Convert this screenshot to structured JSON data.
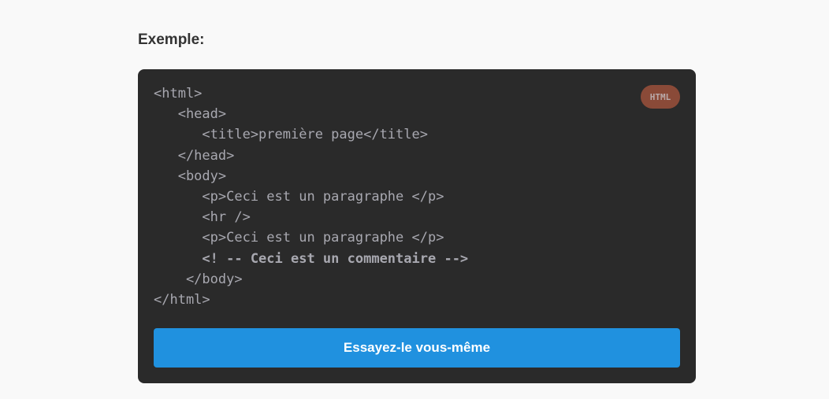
{
  "heading": "Exemple:",
  "code_block": {
    "language_badge": "HTML",
    "lines": [
      "<html>",
      "   <head>",
      "      <title>première page</title>",
      "   </head>",
      "   <body>",
      "      <p>Ceci est un paragraphe </p>",
      "      <hr />",
      "      <p>Ceci est un paragraphe </p>",
      "      <! -- Ceci est un commentaire -->",
      "    </body>",
      "</html>"
    ],
    "bold_line_index": 8
  },
  "try_button": "Essayez-le vous-même",
  "colors": {
    "button": "#2091df",
    "badge": "#8a4a38",
    "code_bg": "#2a2a2a"
  }
}
